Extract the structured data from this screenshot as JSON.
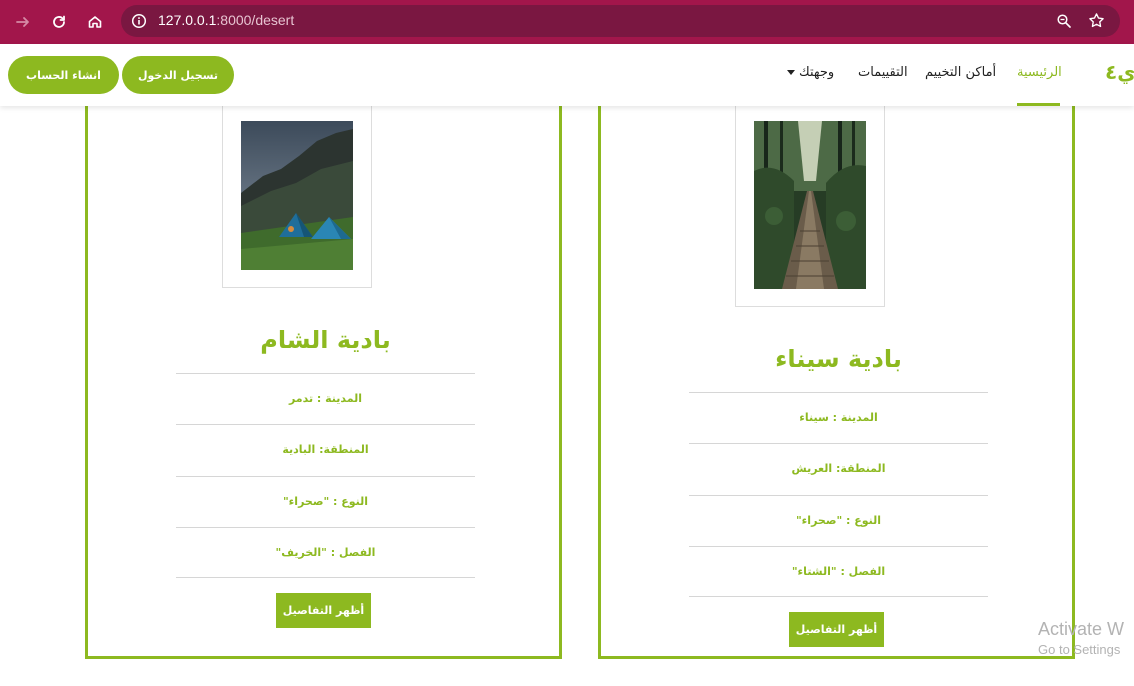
{
  "browser": {
    "url_host": "127.0.0.1",
    "url_rest": ":8000/desert",
    "icons": [
      "arrow-forward-icon",
      "reload-icon",
      "home-icon",
      "info-icon",
      "zoom-icon",
      "bookmark-star-icon"
    ],
    "chrome_color": "#a2164b"
  },
  "navbar": {
    "brand": "ي٤",
    "links": {
      "home": "الرئيسية",
      "camping": "أماكن التخييم",
      "ratings": "التقييمات",
      "destination": "وجهتك"
    },
    "login_button": "تسجيل الدخول",
    "signup_button": "انشاء الحساب",
    "accent_color": "#8db920"
  },
  "cards": [
    {
      "title": "بادية الشام",
      "photo": "camping-tents-mountain-photo",
      "rows": [
        "المدينة : تدمر",
        "المنطقة: البادية",
        "النوع : \"صحراء\"",
        "الفصل : \"الخريف\""
      ],
      "button": "أظهر التفاصيل"
    },
    {
      "title": "بادية سيناء",
      "photo": "forest-bridge-photo",
      "rows": [
        "المدينة : سيناء",
        "المنطقة: العريش",
        "النوع : \"صحراء\"",
        "الفصل : \"الشتاء\""
      ],
      "button": "أظهر التفاصيل"
    }
  ],
  "watermark": {
    "line1": "Activate W",
    "line2": "Go to Settings"
  }
}
